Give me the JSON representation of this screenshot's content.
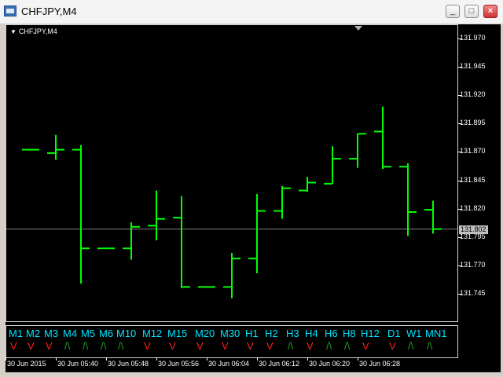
{
  "window": {
    "title": "CHFJPY,M4",
    "buttons": {
      "minimize": "_",
      "maximize": "□",
      "close": "×"
    }
  },
  "chart": {
    "symbol_label": "CHFJPY,M4",
    "current_price": "131.802",
    "colors": {
      "background": "#000000",
      "bars": "#00ff00",
      "axis_text": "#ffffff",
      "price_line": "#808080"
    }
  },
  "timeframes": [
    {
      "label": "M1",
      "signal": "V",
      "direction": "down"
    },
    {
      "label": "M2",
      "signal": "V",
      "direction": "down"
    },
    {
      "label": "M3",
      "signal": "V",
      "direction": "down"
    },
    {
      "label": "M4",
      "signal": "/\\",
      "direction": "up"
    },
    {
      "label": "M5",
      "signal": "/\\",
      "direction": "up"
    },
    {
      "label": "M6",
      "signal": "/\\",
      "direction": "up"
    },
    {
      "label": "M10",
      "signal": "/\\",
      "direction": "up"
    },
    {
      "label": "M12",
      "signal": "V",
      "direction": "down"
    },
    {
      "label": "M15",
      "signal": "V",
      "direction": "down"
    },
    {
      "label": "M20",
      "signal": "V",
      "direction": "down"
    },
    {
      "label": "M30",
      "signal": "V",
      "direction": "down"
    },
    {
      "label": "H1",
      "signal": "V",
      "direction": "down"
    },
    {
      "label": "H2",
      "signal": "V",
      "direction": "down"
    },
    {
      "label": "H3",
      "signal": "/\\",
      "direction": "up"
    },
    {
      "label": "H4",
      "signal": "V",
      "direction": "down"
    },
    {
      "label": "H6",
      "signal": "/\\",
      "direction": "up"
    },
    {
      "label": "H8",
      "signal": "/\\",
      "direction": "up"
    },
    {
      "label": "H12",
      "signal": "V",
      "direction": "down"
    },
    {
      "label": "D1",
      "signal": "V",
      "direction": "down"
    },
    {
      "label": "W1",
      "signal": "/\\",
      "direction": "up"
    },
    {
      "label": "MN1",
      "signal": "/\\",
      "direction": "up"
    }
  ],
  "chart_data": {
    "type": "ohlc",
    "y_ticks": [
      "131.970",
      "131.945",
      "131.920",
      "131.895",
      "131.870",
      "131.845",
      "131.820",
      "131.795",
      "131.770",
      "131.745"
    ],
    "x_ticks": [
      "30 Jun 2015",
      "30 Jun 05:40",
      "30 Jun 05:48",
      "30 Jun 05:56",
      "30 Jun 06:04",
      "30 Jun 06:12",
      "30 Jun 06:20",
      "30 Jun 06:28"
    ],
    "ylim": [
      131.736,
      131.98
    ],
    "bars": [
      {
        "open": 131.872,
        "high": 131.872,
        "low": 131.872,
        "close": 131.872
      },
      {
        "open": 131.869,
        "high": 131.885,
        "low": 131.863,
        "close": 131.872
      },
      {
        "open": 131.872,
        "high": 131.876,
        "low": 131.754,
        "close": 131.785
      },
      {
        "open": 131.785,
        "high": 131.785,
        "low": 131.785,
        "close": 131.785
      },
      {
        "open": 131.785,
        "high": 131.808,
        "low": 131.775,
        "close": 131.804
      },
      {
        "open": 131.805,
        "high": 131.836,
        "low": 131.792,
        "close": 131.811
      },
      {
        "open": 131.812,
        "high": 131.831,
        "low": 131.75,
        "close": 131.751
      },
      {
        "open": 131.751,
        "high": 131.751,
        "low": 131.751,
        "close": 131.751
      },
      {
        "open": 131.751,
        "high": 131.781,
        "low": 131.741,
        "close": 131.776
      },
      {
        "open": 131.776,
        "high": 131.833,
        "low": 131.763,
        "close": 131.818
      },
      {
        "open": 131.818,
        "high": 131.84,
        "low": 131.811,
        "close": 131.838
      },
      {
        "open": 131.836,
        "high": 131.848,
        "low": 131.835,
        "close": 131.843
      },
      {
        "open": 131.842,
        "high": 131.875,
        "low": 131.842,
        "close": 131.864
      },
      {
        "open": 131.864,
        "high": 131.886,
        "low": 131.856,
        "close": 131.886
      },
      {
        "open": 131.888,
        "high": 131.91,
        "low": 131.855,
        "close": 131.857
      },
      {
        "open": 131.857,
        "high": 131.86,
        "low": 131.796,
        "close": 131.817
      },
      {
        "open": 131.819,
        "high": 131.827,
        "low": 131.798,
        "close": 131.802
      }
    ]
  }
}
